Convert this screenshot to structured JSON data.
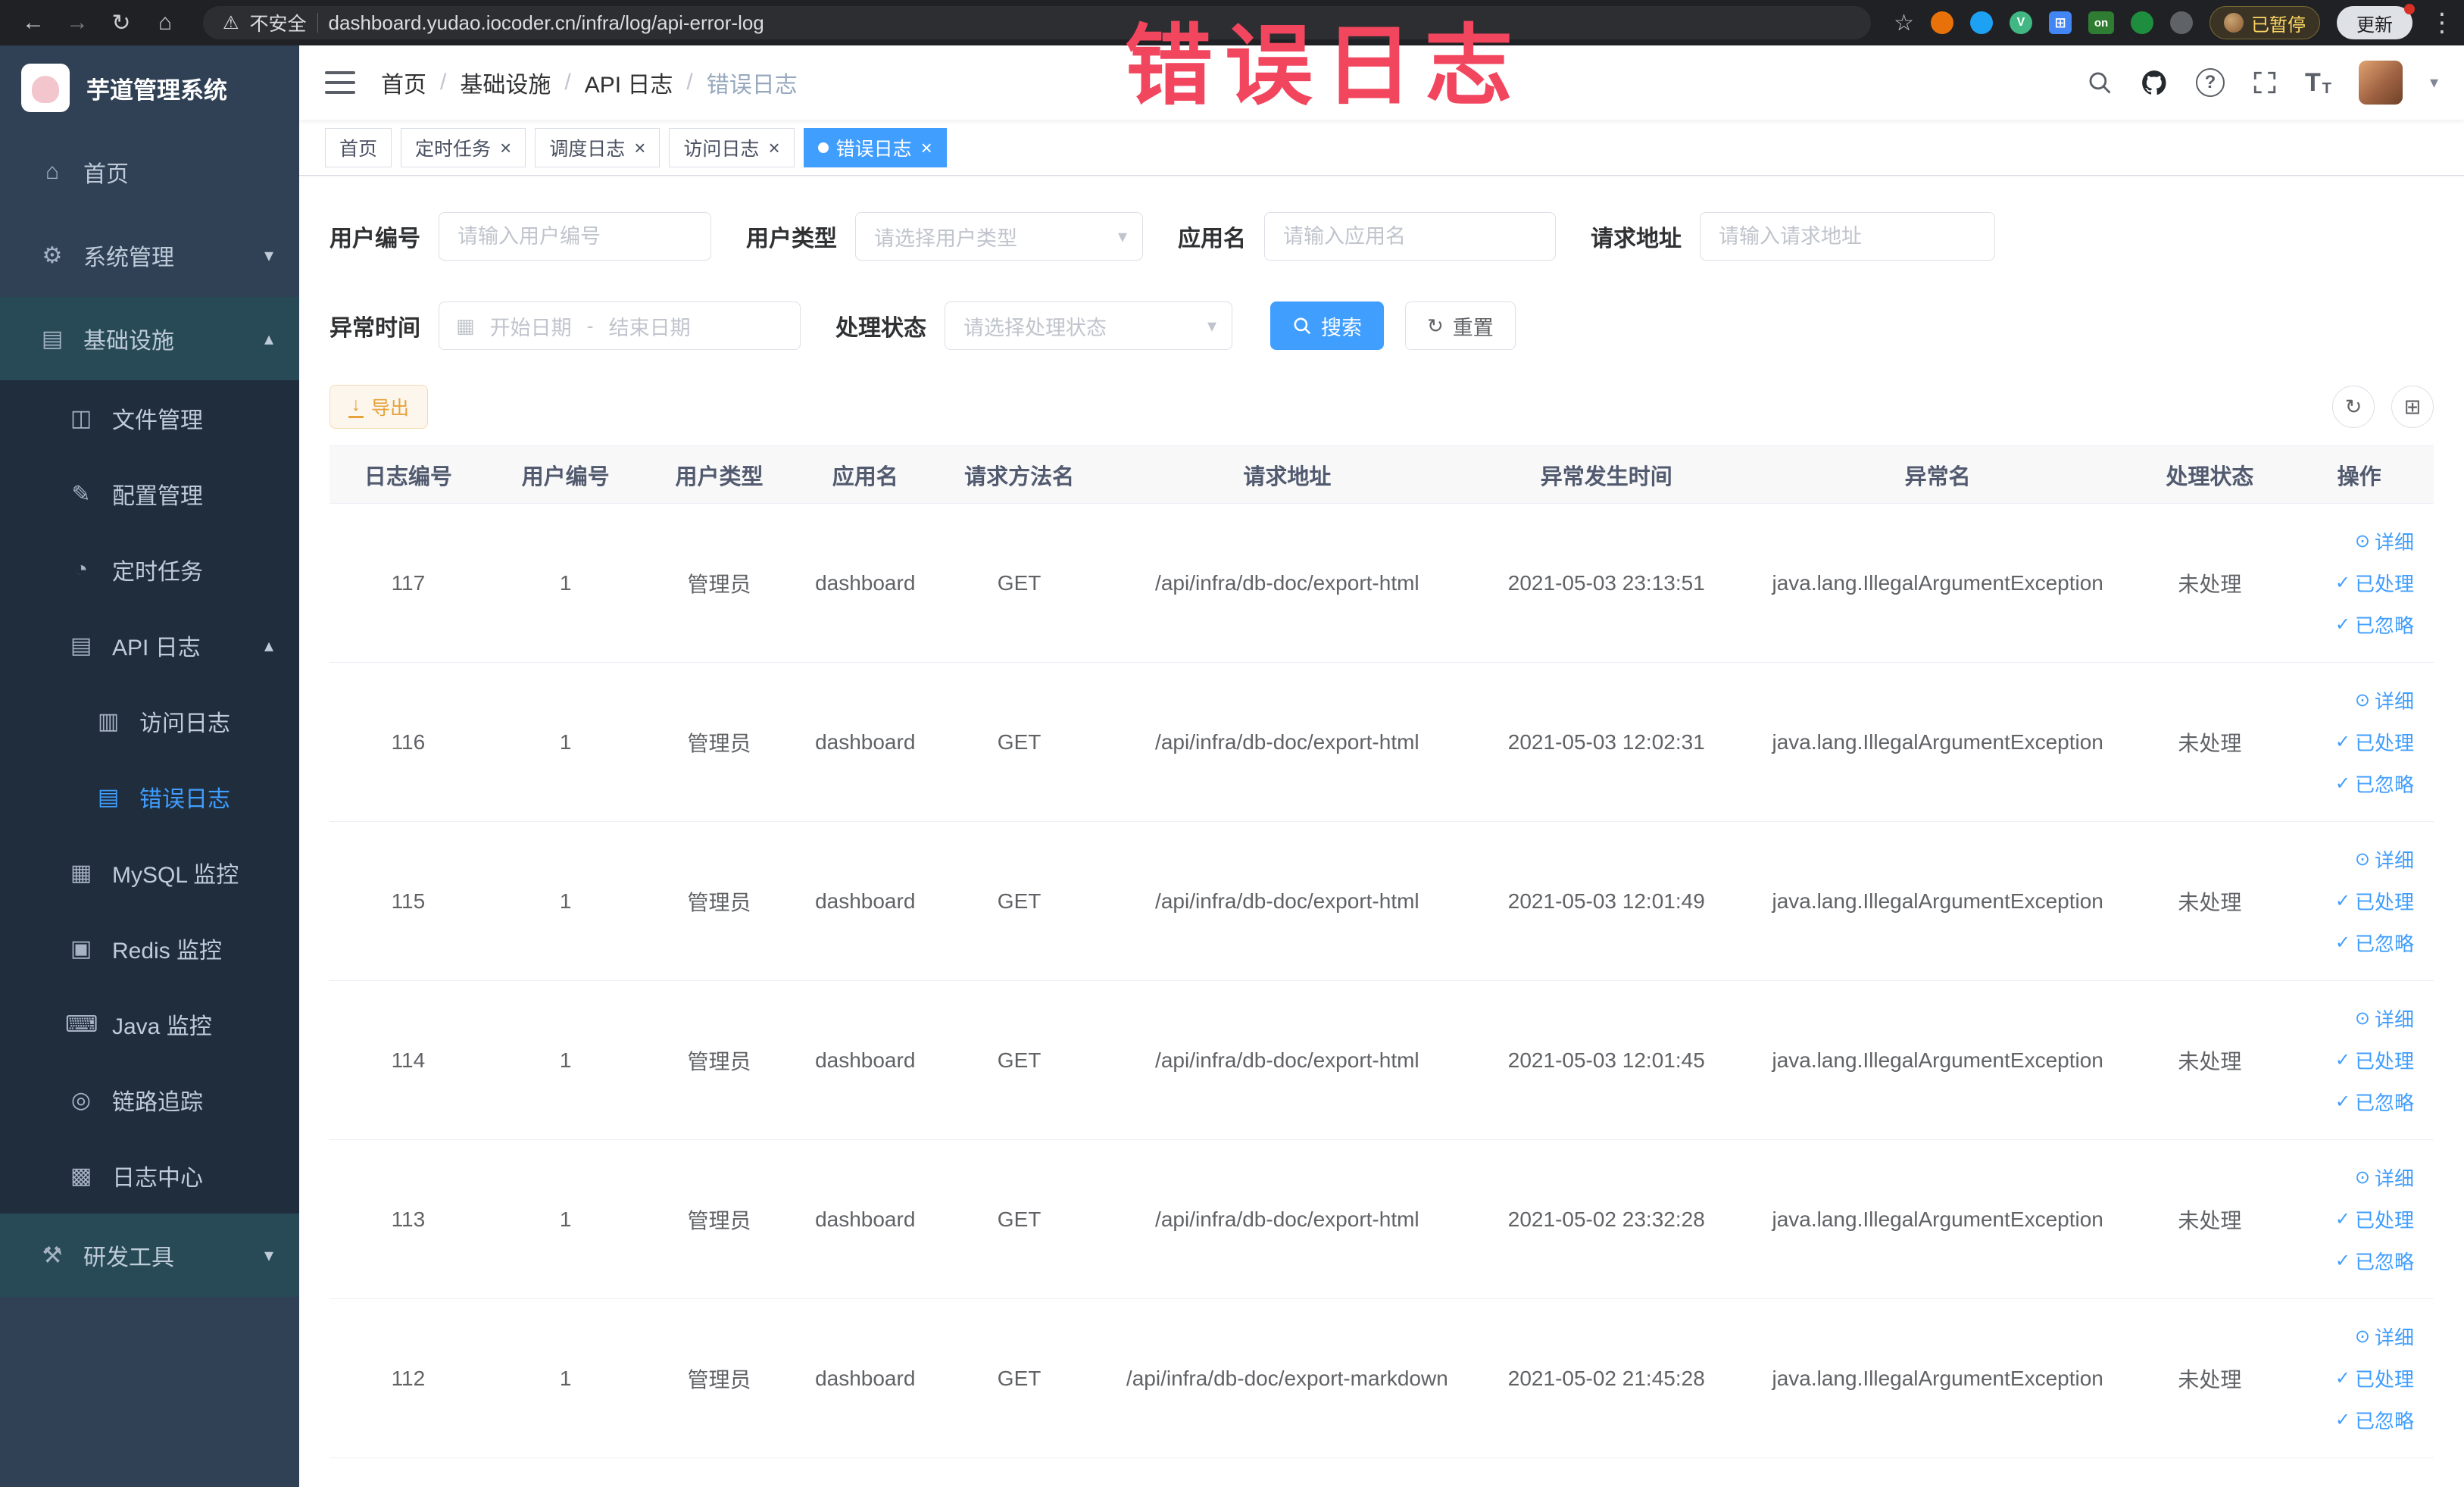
{
  "browser": {
    "security_label": "不安全",
    "url": "dashboard.yudao.iocoder.cn/infra/log/api-error-log",
    "paused_badge": "已暂停",
    "update_button": "更新"
  },
  "watermark": "错误日志",
  "sidebar": {
    "title": "芋道管理系统",
    "items": [
      {
        "name": "home",
        "label": "首页",
        "icon": "home-icon",
        "level": 1
      },
      {
        "name": "system-mgmt",
        "label": "系统管理",
        "icon": "gear-icon",
        "level": 1,
        "chevron": "down"
      },
      {
        "name": "infrastructure",
        "label": "基础设施",
        "icon": "infra-icon",
        "level": 1,
        "chevron": "up",
        "tinted": true
      },
      {
        "name": "file-mgmt",
        "label": "文件管理",
        "icon": "file-icon",
        "level": 2
      },
      {
        "name": "config-mgmt",
        "label": "配置管理",
        "icon": "config-icon",
        "level": 2
      },
      {
        "name": "scheduled-jobs",
        "label": "定时任务",
        "icon": "timer-icon",
        "level": 2
      },
      {
        "name": "api-log",
        "label": "API 日志",
        "icon": "api-log-icon",
        "level": 2,
        "chevron": "up"
      },
      {
        "name": "access-log",
        "label": "访问日志",
        "icon": "access-log-icon",
        "level": 3
      },
      {
        "name": "error-log",
        "label": "错误日志",
        "icon": "error-log-icon",
        "level": 3,
        "active": true
      },
      {
        "name": "mysql-monitor",
        "label": "MySQL 监控",
        "icon": "mysql-icon",
        "level": 2
      },
      {
        "name": "redis-monitor",
        "label": "Redis 监控",
        "icon": "redis-icon",
        "level": 2
      },
      {
        "name": "java-monitor",
        "label": "Java 监控",
        "icon": "java-icon",
        "level": 2
      },
      {
        "name": "trace",
        "label": "链路追踪",
        "icon": "trace-icon",
        "level": 2
      },
      {
        "name": "log-center",
        "label": "日志中心",
        "icon": "log-center-icon",
        "level": 2
      },
      {
        "name": "dev-tools",
        "label": "研发工具",
        "icon": "devtools-icon",
        "level": 1,
        "chevron": "down",
        "tinted": true
      }
    ]
  },
  "breadcrumb": [
    "首页",
    "基础设施",
    "API 日志",
    "错误日志"
  ],
  "tabs": [
    {
      "name": "home",
      "label": "首页",
      "closable": false,
      "active": false
    },
    {
      "name": "job",
      "label": "定时任务",
      "closable": true,
      "active": false
    },
    {
      "name": "job-log",
      "label": "调度日志",
      "closable": true,
      "active": false
    },
    {
      "name": "access-log",
      "label": "访问日志",
      "closable": true,
      "active": false
    },
    {
      "name": "error-log",
      "label": "错误日志",
      "closable": true,
      "active": true
    }
  ],
  "filters": {
    "user_id": {
      "label": "用户编号",
      "placeholder": "请输入用户编号"
    },
    "user_type": {
      "label": "用户类型",
      "placeholder": "请选择用户类型"
    },
    "app_name": {
      "label": "应用名",
      "placeholder": "请输入应用名"
    },
    "request_url": {
      "label": "请求地址",
      "placeholder": "请输入请求地址"
    },
    "exception_time": {
      "label": "异常时间",
      "start_placeholder": "开始日期",
      "separator": "-",
      "end_placeholder": "结束日期"
    },
    "process_status": {
      "label": "处理状态",
      "placeholder": "请选择处理状态"
    },
    "search_button": "搜索",
    "reset_button": "重置"
  },
  "toolbar": {
    "export_button": "导出"
  },
  "table": {
    "columns": [
      "日志编号",
      "用户编号",
      "用户类型",
      "应用名",
      "请求方法名",
      "请求地址",
      "异常发生时间",
      "异常名",
      "处理状态",
      "操作"
    ],
    "actions": [
      {
        "label": "详细",
        "icon": "view-icon"
      },
      {
        "label": "已处理",
        "icon": "check-icon"
      },
      {
        "label": "已忽略",
        "icon": "check-icon"
      }
    ],
    "rows": [
      {
        "log_id": "117",
        "user_id": "1",
        "user_type": "管理员",
        "app_name": "dashboard",
        "method": "GET",
        "url": "/api/infra/db-doc/export-html",
        "time": "2021-05-03 23:13:51",
        "exception": "java.lang.IllegalArgumentException",
        "status": "未处理"
      },
      {
        "log_id": "116",
        "user_id": "1",
        "user_type": "管理员",
        "app_name": "dashboard",
        "method": "GET",
        "url": "/api/infra/db-doc/export-html",
        "time": "2021-05-03 12:02:31",
        "exception": "java.lang.IllegalArgumentException",
        "status": "未处理"
      },
      {
        "log_id": "115",
        "user_id": "1",
        "user_type": "管理员",
        "app_name": "dashboard",
        "method": "GET",
        "url": "/api/infra/db-doc/export-html",
        "time": "2021-05-03 12:01:49",
        "exception": "java.lang.IllegalArgumentException",
        "status": "未处理"
      },
      {
        "log_id": "114",
        "user_id": "1",
        "user_type": "管理员",
        "app_name": "dashboard",
        "method": "GET",
        "url": "/api/infra/db-doc/export-html",
        "time": "2021-05-03 12:01:45",
        "exception": "java.lang.IllegalArgumentException",
        "status": "未处理"
      },
      {
        "log_id": "113",
        "user_id": "1",
        "user_type": "管理员",
        "app_name": "dashboard",
        "method": "GET",
        "url": "/api/infra/db-doc/export-html",
        "time": "2021-05-02 23:32:28",
        "exception": "java.lang.IllegalArgumentException",
        "status": "未处理"
      },
      {
        "log_id": "112",
        "user_id": "1",
        "user_type": "管理员",
        "app_name": "dashboard",
        "method": "GET",
        "url": "/api/infra/db-doc/export-markdown",
        "time": "2021-05-02 21:45:28",
        "exception": "java.lang.IllegalArgumentException",
        "status": "未处理"
      }
    ]
  },
  "icons": {
    "back-icon": "←",
    "forward-icon": "→",
    "reload-icon": "↻",
    "home-nav-icon": "⌂",
    "warning-icon": "⚠",
    "star-icon": "☆",
    "kebab-icon": "⋮",
    "close-icon": "×",
    "question-icon": "?",
    "font-size-icon": "T",
    "caret-down-icon": "▾",
    "calendar-icon": "▦",
    "refresh-icon": "↻",
    "grid-icon": "⊞",
    "download-icon": "↓",
    "view-icon": "⊙",
    "check-icon": "✓",
    "ext-vue-icon": "V",
    "ext-on-icon": "on",
    "home-icon": "⌂",
    "gear-icon": "⚙",
    "infra-icon": "▤",
    "file-icon": "◫",
    "config-icon": "✎",
    "timer-icon": "◔",
    "api-log-icon": "▤",
    "access-log-icon": "▥",
    "error-log-icon": "▤",
    "mysql-icon": "▦",
    "redis-icon": "▣",
    "java-icon": "⌨",
    "trace-icon": "◎",
    "log-center-icon": "▩",
    "devtools-icon": "⚒"
  }
}
